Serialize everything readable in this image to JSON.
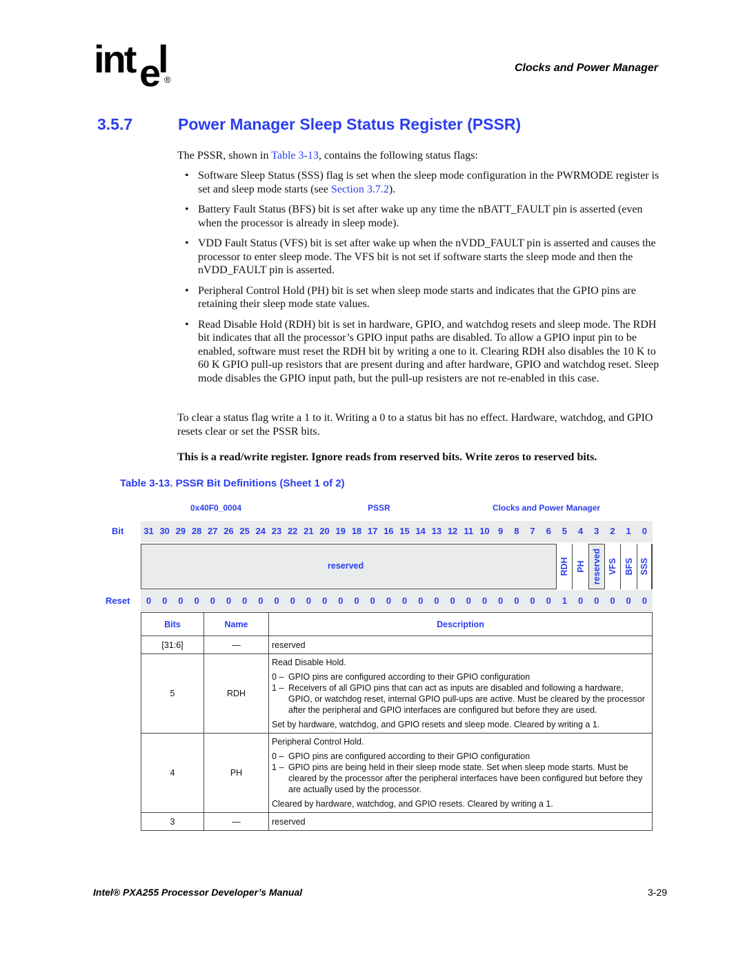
{
  "header": {
    "logo_text": "intel",
    "logo_registered": "®",
    "chapter": "Clocks and Power Manager"
  },
  "section": {
    "number": "3.5.7",
    "title": "Power Manager Sleep Status Register (PSSR)"
  },
  "intro": {
    "before_link": "The PSSR, shown in ",
    "link": "Table 3-13",
    "after_link": ", contains the following status flags:"
  },
  "bullets": [
    {
      "text": "Software Sleep Status (SSS) flag is set when the sleep mode configuration in the PWRMODE register is set and sleep mode starts (see ",
      "link": "Section 3.7.2",
      "tail": ")."
    },
    {
      "text": "Battery Fault Status (BFS) bit is set after wake up any time the nBATT_FAULT pin is asserted (even when the processor is already in sleep mode).",
      "link": "",
      "tail": ""
    },
    {
      "text": "VDD Fault Status (VFS) bit is set after wake up when the nVDD_FAULT pin is asserted and causes the processor to enter sleep mode. The VFS bit is not set if software starts the sleep mode and then the nVDD_FAULT pin is asserted.",
      "link": "",
      "tail": ""
    },
    {
      "text": "Peripheral Control Hold (PH) bit is set when sleep mode starts and indicates that the GPIO pins are retaining their sleep mode state values.",
      "link": "",
      "tail": ""
    },
    {
      "text": "Read Disable Hold (RDH) bit is set in hardware, GPIO, and watchdog resets and sleep mode. The RDH bit indicates that all the processor’s GPIO input paths are disabled. To allow a GPIO input pin to be enabled, software must reset the RDH bit by writing a one to it. Clearing RDH also disables the 10 K to 60 K GPIO pull-up resistors that are present during and after hardware, GPIO and watchdog reset. Sleep mode disables the GPIO input path, but the pull-up resisters are not re-enabled in this case.",
      "link": "",
      "tail": ""
    }
  ],
  "clear_paragraph": "To clear a status flag write a 1 to it. Writing a 0 to a status bit has no effect. Hardware, watchdog, and GPIO resets clear or set the PSSR bits.",
  "bold_note": "This is a read/write register. Ignore reads from reserved bits. Write zeros to reserved bits.",
  "table_caption": "Table 3-13. PSSR Bit Definitions (Sheet 1 of 2)",
  "register": {
    "address": "0x40F0_0004",
    "name": "PSSR",
    "unit": "Clocks and Power Manager",
    "bit_label": "Bit",
    "reset_label": "Reset",
    "bits": [
      "31",
      "30",
      "29",
      "28",
      "27",
      "26",
      "25",
      "24",
      "23",
      "22",
      "21",
      "20",
      "19",
      "18",
      "17",
      "16",
      "15",
      "14",
      "13",
      "12",
      "11",
      "10",
      "9",
      "8",
      "7",
      "6",
      "5",
      "4",
      "3",
      "2",
      "1",
      "0"
    ],
    "reset_values": [
      "0",
      "0",
      "0",
      "0",
      "0",
      "0",
      "0",
      "0",
      "0",
      "0",
      "0",
      "0",
      "0",
      "0",
      "0",
      "0",
      "0",
      "0",
      "0",
      "0",
      "0",
      "0",
      "0",
      "0",
      "0",
      "0",
      "1",
      "0",
      "0",
      "0",
      "0",
      "0"
    ],
    "fields": {
      "reserved_high": "reserved",
      "rdh": "RDH",
      "ph": "PH",
      "reserved_bit3": "reserved",
      "vfs": "VFS",
      "bfs": "BFS",
      "sss": "SSS"
    }
  },
  "defs_table": {
    "headers": {
      "bits": "Bits",
      "name": "Name",
      "description": "Description"
    },
    "rows": [
      {
        "bits": "[31:6]",
        "name": "—",
        "desc_title": "reserved"
      },
      {
        "bits": "5",
        "name": "RDH",
        "desc_title": "Read Disable Hold.",
        "opt0_key": "0 –",
        "opt0": "GPIO pins are configured according to their GPIO configuration",
        "opt1_key": "1 –",
        "opt1": "Receivers of all GPIO pins that can act as inputs are disabled and following a hardware, GPIO, or watchdog reset, internal GPIO pull-ups are active. Must be cleared by the processor after the peripheral and GPIO interfaces are configured but before they are used.",
        "note": "Set by hardware, watchdog, and GPIO resets and sleep mode. Cleared by writing a 1."
      },
      {
        "bits": "4",
        "name": "PH",
        "desc_title": "Peripheral Control Hold.",
        "opt0_key": "0 –",
        "opt0": "GPIO pins are configured according to their GPIO configuration",
        "opt1_key": "1 –",
        "opt1": "GPIO pins are being held in their sleep mode state. Set when sleep mode starts. Must be cleared by the processor after the peripheral interfaces have been configured but before they are actually used by the processor.",
        "note": "Cleared by hardware, watchdog, and GPIO resets. Cleared by writing a 1."
      },
      {
        "bits": "3",
        "name": "—",
        "desc_title": "reserved"
      }
    ]
  },
  "footer": {
    "title": "Intel® PXA255 Processor Developer’s Manual",
    "page": "3-29"
  }
}
